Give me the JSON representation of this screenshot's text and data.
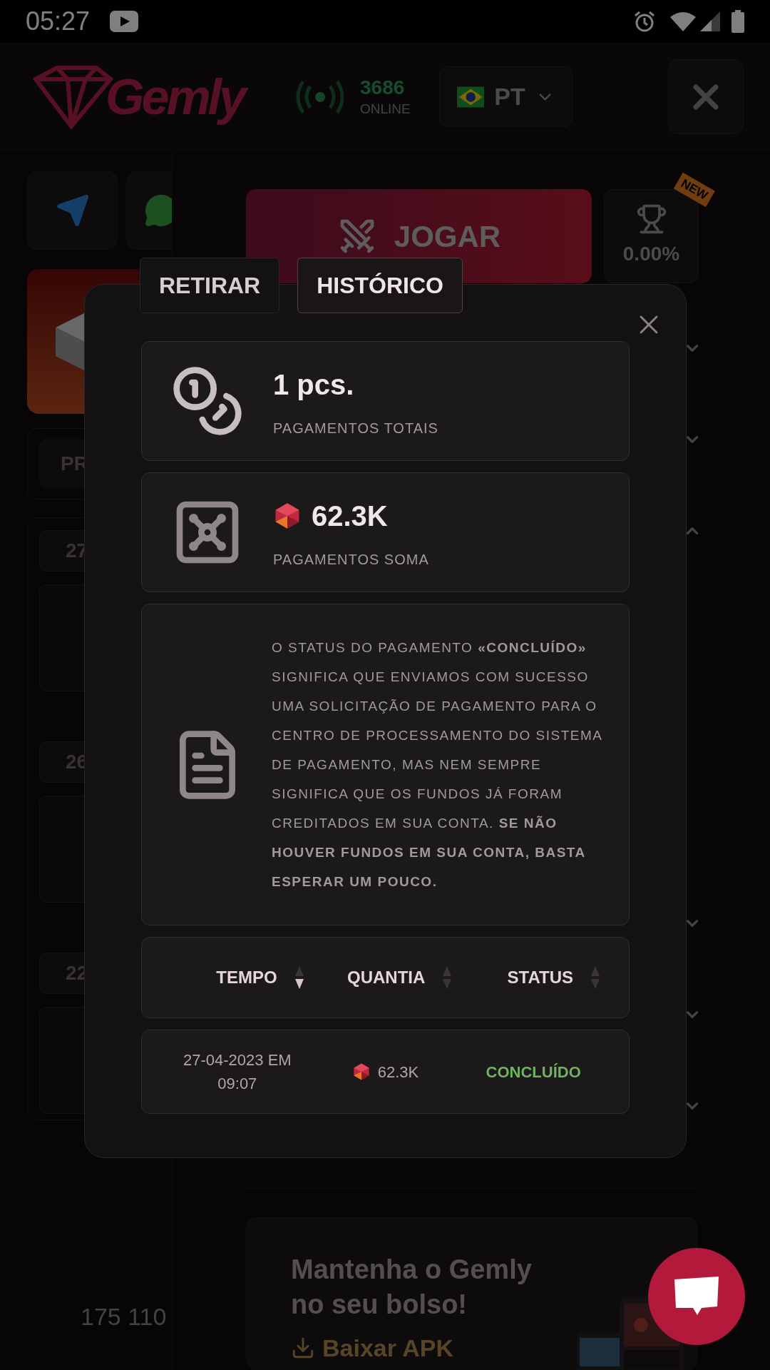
{
  "status_bar": {
    "time": "05:27"
  },
  "header": {
    "logo": "Gemly",
    "online_count": "3686",
    "online_label": "ONLINE",
    "language": "PT"
  },
  "background": {
    "play_button": "JOGAR",
    "trophy": {
      "badge": "NEW",
      "value": "0.00%"
    },
    "promo_tab": "PR",
    "day_chips": [
      "27",
      "26",
      "22"
    ],
    "faq_items": [
      {
        "expanded": false
      },
      {
        "expanded": false
      },
      {
        "expanded": true
      },
      {
        "expanded": false
      },
      {
        "expanded": false
      },
      {
        "expanded": false
      }
    ],
    "balance": "175 110",
    "promo": {
      "title": "Mantenha o Gemly no seu bolso!",
      "link": "Baixar APK"
    }
  },
  "modal": {
    "tabs": [
      {
        "label": "RETIRAR",
        "selected": false
      },
      {
        "label": "HISTÓRICO",
        "selected": true
      }
    ],
    "stats": [
      {
        "kind": "count",
        "value": "1 pcs.",
        "label": "PAGAMENTOS TOTAIS"
      },
      {
        "kind": "sum",
        "value": "62.3K",
        "label": "PAGAMENTOS SOMA"
      }
    ],
    "notice": "O STATUS DO PAGAMENTO **«CONCLUÍDO»** SIGNIFICA QUE ENVIAMOS COM SUCESSO UMA SOLICITAÇÃO DE PAGAMENTO PARA O CENTRO DE PROCESSAMENTO DO SISTEMA DE PAGAMENTO, MAS NEM SEMPRE SIGNIFICA QUE OS FUNDOS JÁ FORAM CREDITADOS EM SUA CONTA. **SE NÃO HOUVER FUNDOS EM SUA CONTA, BASTA ESPERAR UM POUCO.**",
    "table": {
      "columns": [
        {
          "label": "TEMPO",
          "sorted": true
        },
        {
          "label": "QUANTIA",
          "sorted": false
        },
        {
          "label": "STATUS",
          "sorted": false
        }
      ],
      "rows": [
        {
          "time": "27-04-2023 EM 09:07",
          "amount": "62.3K",
          "status": "CONCLUÍDO",
          "completed": true
        }
      ]
    }
  }
}
